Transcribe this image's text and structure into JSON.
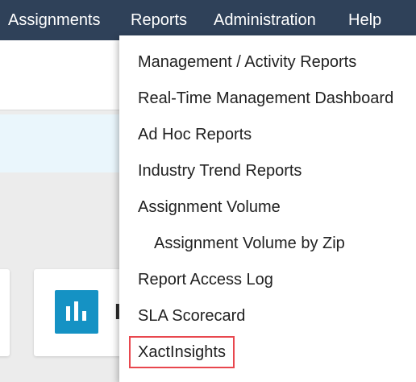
{
  "nav": {
    "items": [
      {
        "label": "Assignments"
      },
      {
        "label": "Reports"
      },
      {
        "label": "Administration"
      },
      {
        "label": "Help"
      }
    ]
  },
  "reports_menu": {
    "items": [
      {
        "label": "Management / Activity Reports"
      },
      {
        "label": "Real-Time Management Dashboard"
      },
      {
        "label": "Ad Hoc Reports"
      },
      {
        "label": "Industry Trend Reports"
      },
      {
        "label": "Assignment Volume"
      },
      {
        "label": "Assignment Volume by Zip",
        "indent": true
      },
      {
        "label": "Report Access Log"
      },
      {
        "label": "SLA Scorecard"
      },
      {
        "label": "XactInsights",
        "highlighted": true
      }
    ]
  },
  "card": {
    "icon": "bar-chart-icon",
    "icon_color": "#1592c4",
    "label_partial": "I"
  },
  "colors": {
    "nav_background": "#2f4159",
    "highlight_border": "#e8474e",
    "banner_background": "#eaf6fc"
  }
}
